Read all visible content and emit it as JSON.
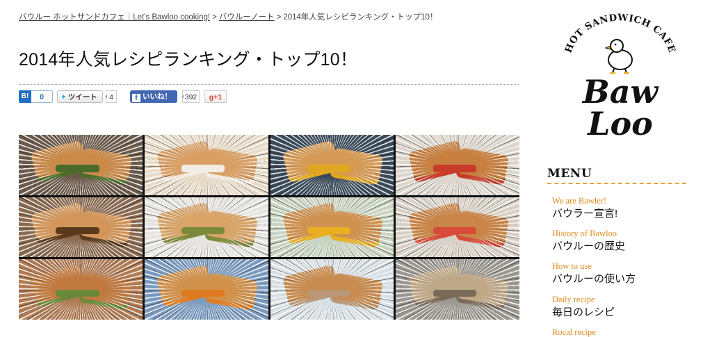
{
  "breadcrumb": {
    "items": [
      {
        "label": "バウルー ホットサンドカフェ｜Let's Bawloo cooking!",
        "link": true
      },
      {
        "label": "バウルーノート",
        "link": true
      },
      {
        "label": "2014年人気レシピランキング・トップ10！",
        "link": false
      }
    ],
    "separator": ">"
  },
  "page_title": "2014年人気レシピランキング・トップ10！",
  "social": {
    "hatena": {
      "icon": "B!",
      "count": "0"
    },
    "tweet": {
      "label": "ツイート",
      "count": "4"
    },
    "like": {
      "label": "いいね！",
      "count": "392"
    },
    "gplus": {
      "label": "g+1"
    }
  },
  "gallery": {
    "tiles": [
      {
        "bg": "#6b5a4a",
        "bread": "#c98a4a",
        "filling": "#4a6b2a"
      },
      {
        "bg": "#e8dcc8",
        "bread": "#d9a066",
        "filling": "#f2ede4"
      },
      {
        "bg": "#3a4a5a",
        "bread": "#d59a55",
        "filling": "#e0a820"
      },
      {
        "bg": "#dcd6cc",
        "bread": "#c7803f",
        "filling": "#c83a2a"
      },
      {
        "bg": "#8a6a50",
        "bread": "#d2955a",
        "filling": "#5a3a1a"
      },
      {
        "bg": "#e6e4e0",
        "bread": "#d8a468",
        "filling": "#7a8a3a"
      },
      {
        "bg": "#c8d4c0",
        "bread": "#cf9250",
        "filling": "#e8b020"
      },
      {
        "bg": "#d8d0c6",
        "bread": "#c98548",
        "filling": "#d84a3a"
      },
      {
        "bg": "#b07a52",
        "bread": "#c07a40",
        "filling": "#6a8a3a"
      },
      {
        "bg": "#7a9ac0",
        "bread": "#d0924c",
        "filling": "#e07a20"
      },
      {
        "bg": "#d8e0e6",
        "bread": "#c88c50",
        "filling": "#b89878"
      },
      {
        "bg": "#9a9690",
        "bread": "#bfa888",
        "filling": "#7a6a5a"
      }
    ]
  },
  "sidebar": {
    "logo": {
      "arc_text": "HOT SANDWICH CAFE",
      "word1": "Baw",
      "word2": "Loo"
    },
    "menu_heading": "MENU",
    "menu_items": [
      {
        "en": "We are Bawler!",
        "jp": "バウラー宣言!"
      },
      {
        "en": "History of Bawloo",
        "jp": "バウルーの歴史"
      },
      {
        "en": "How to use",
        "jp": "バウルーの使い方"
      },
      {
        "en": "Daily recipe",
        "jp": "毎日のレシピ"
      },
      {
        "en": "Rocal recipe",
        "jp": ""
      }
    ]
  },
  "colors": {
    "menu_accent": "#e08a1e",
    "facebook": "#4267b2",
    "hatena": "#1f6fbf",
    "twitter": "#2aa3ef",
    "gplus": "#d73d32"
  }
}
